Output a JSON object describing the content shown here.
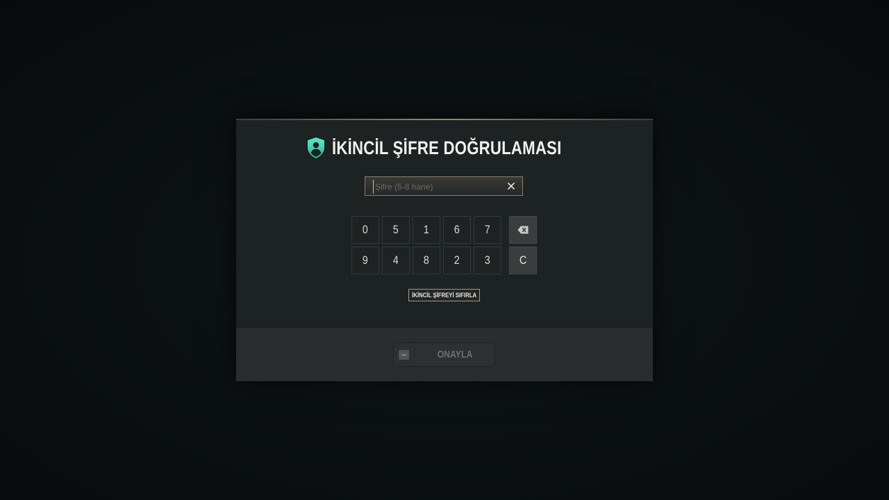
{
  "dialog": {
    "title": "İKİNCİL ŞİFRE DOĞRULAMASI",
    "title_icon": "shield-user-icon",
    "accent_color": "#3fd6b6"
  },
  "password_field": {
    "value": "",
    "placeholder": "Şifre (6-8 hane)",
    "clear_icon": "close-icon"
  },
  "keypad": {
    "row1": [
      "0",
      "5",
      "1",
      "6",
      "7"
    ],
    "row2": [
      "9",
      "4",
      "8",
      "2",
      "3"
    ],
    "backspace_icon": "backspace-icon",
    "clear_label": "C"
  },
  "reset_button": {
    "label": "İKİNCİL ŞİFREYİ SIFIRLA"
  },
  "footer": {
    "confirm_label": "ONAYLA",
    "confirm_key_icon": "keyboard-key-icon"
  }
}
